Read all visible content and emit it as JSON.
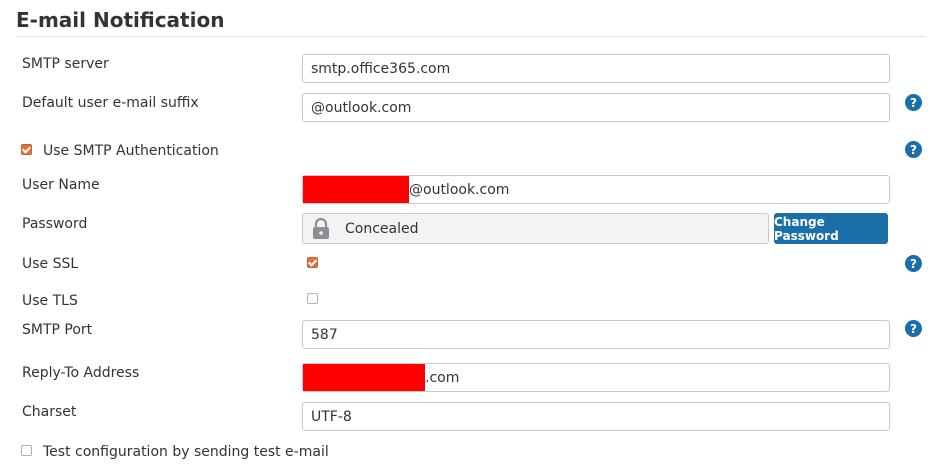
{
  "section_title": "E-mail Notification",
  "fields": {
    "smtp_server": {
      "label": "SMTP server",
      "value": "smtp.office365.com"
    },
    "default_suffix": {
      "label": "Default user e-mail suffix",
      "value": "@outlook.com"
    },
    "use_smtp_auth": {
      "label": "Use SMTP Authentication",
      "checked": true
    },
    "user_name": {
      "label": "User Name",
      "value_suffix": "@outlook.com",
      "redacted": true
    },
    "password": {
      "label": "Password",
      "value": "Concealed",
      "button": "Change Password"
    },
    "use_ssl": {
      "label": "Use SSL",
      "checked": true
    },
    "use_tls": {
      "label": "Use TLS",
      "checked": false
    },
    "smtp_port": {
      "label": "SMTP Port",
      "value": "587"
    },
    "reply_to": {
      "label": "Reply-To Address",
      "value_suffix": ".com",
      "redacted": true
    },
    "charset": {
      "label": "Charset",
      "value": "UTF-8"
    },
    "test_config": {
      "label": "Test configuration by sending test e-mail",
      "checked": false
    }
  },
  "icons": {
    "help": "help-circle-icon",
    "lock": "lock-icon",
    "checkbox": "checkbox-icon"
  },
  "colors": {
    "accent": "#1b6fa8",
    "checkbox_on": "#e0743c",
    "redaction": "#ff0000"
  },
  "help_glyph": "?"
}
